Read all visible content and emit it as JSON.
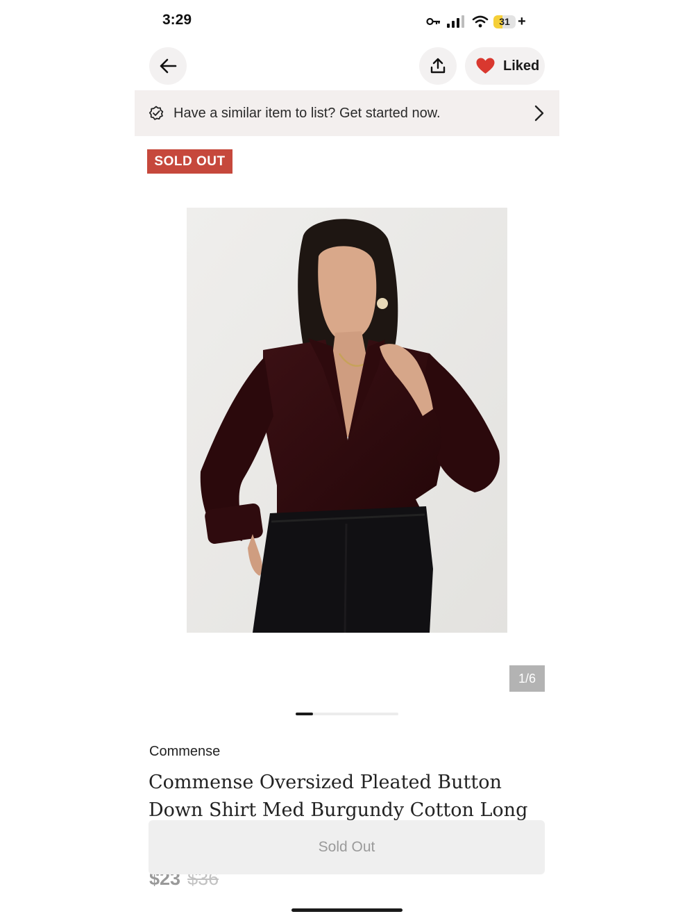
{
  "status_bar": {
    "time": "3:29",
    "battery_level": "31",
    "battery_extra": "+"
  },
  "nav": {
    "liked_label": "Liked",
    "heart_color": "#d9382f"
  },
  "banner": {
    "text": "Have a similar item to list? Get started now."
  },
  "badge": {
    "label": "SOLD OUT",
    "color": "#c6483c"
  },
  "gallery": {
    "counter": "1/6",
    "current_index": 1,
    "total": 6
  },
  "product": {
    "brand": "Commense",
    "title": "Commense Oversized Pleated Button Down Shirt Med Burgundy Cotton Long",
    "price": "$23",
    "original_price": "$36"
  },
  "action": {
    "button_label": "Sold Out"
  }
}
